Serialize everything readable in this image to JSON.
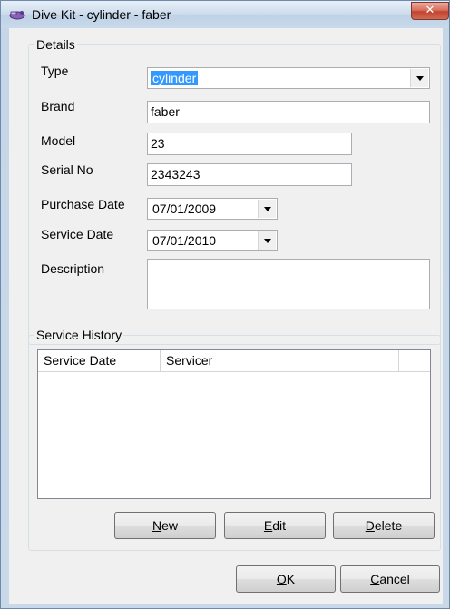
{
  "window": {
    "title": "Dive Kit - cylinder - faber",
    "close_glyph": "✕"
  },
  "details": {
    "label": "Details",
    "type": {
      "label": "Type",
      "value": "cylinder"
    },
    "brand": {
      "label": "Brand",
      "value": "faber"
    },
    "model": {
      "label": "Model",
      "value": "23"
    },
    "serial": {
      "label": "Serial No",
      "value": "2343243"
    },
    "purchase_date": {
      "label": "Purchase Date",
      "value": "07/01/2009"
    },
    "service_date": {
      "label": "Service Date",
      "value": "07/01/2010"
    },
    "description": {
      "label": "Description",
      "value": ""
    }
  },
  "history": {
    "label": "Service History",
    "columns": [
      "Service Date",
      "Servicer",
      ""
    ],
    "rows": [],
    "buttons": {
      "new": {
        "mnemonic": "N",
        "rest": "ew"
      },
      "edit": {
        "mnemonic": "E",
        "rest": "dit"
      },
      "delete": {
        "mnemonic": "D",
        "rest": "elete"
      }
    }
  },
  "footer": {
    "ok": {
      "mnemonic": "O",
      "rest": "K"
    },
    "cancel": {
      "mnemonic": "C",
      "rest": "ancel"
    }
  }
}
